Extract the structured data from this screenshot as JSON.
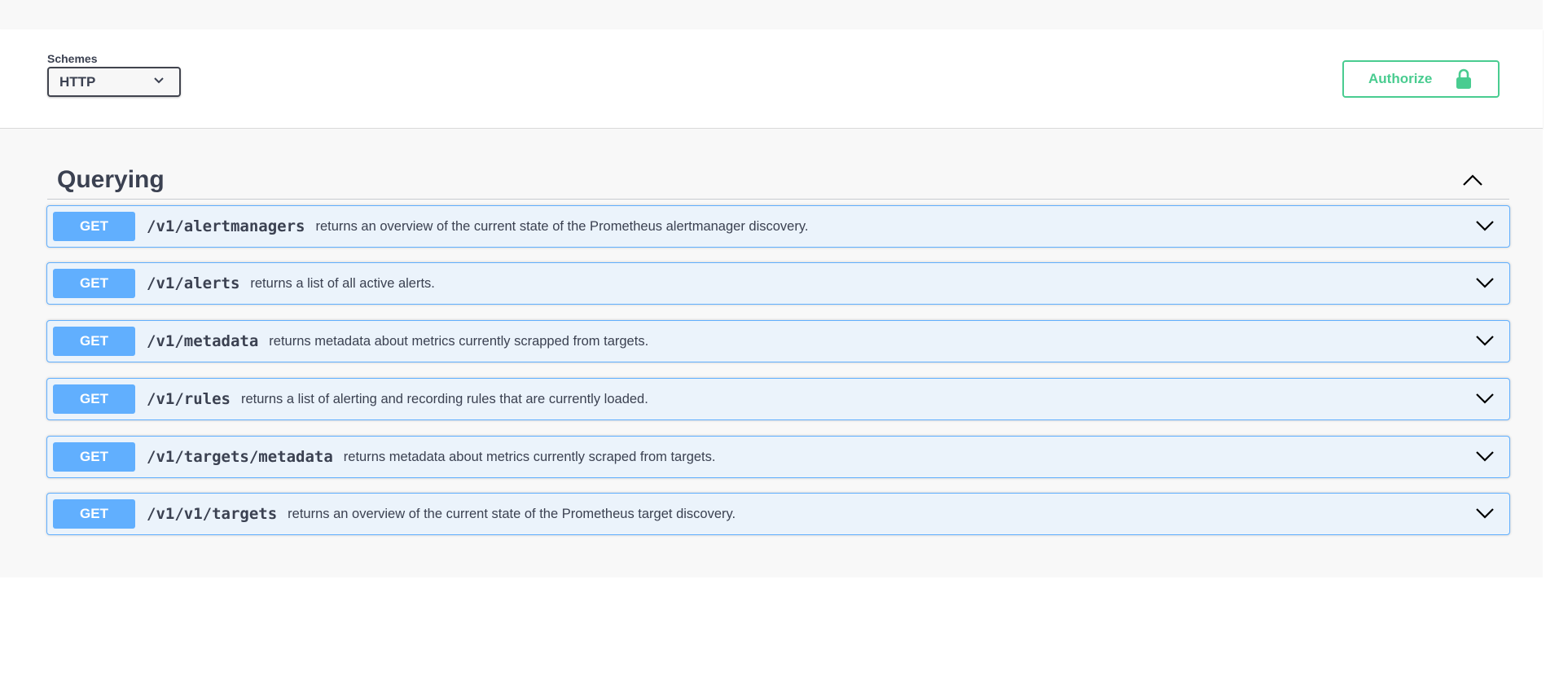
{
  "schemes": {
    "label": "Schemes",
    "selected": "HTTP"
  },
  "authorize": {
    "label": "Authorize",
    "icon": "lock-icon",
    "color": "#49cc90"
  },
  "tag": {
    "title": "Querying",
    "expanded": true
  },
  "operations": [
    {
      "method": "GET",
      "path": "/v1/alertmanagers",
      "summary": "returns an overview of the current state of the Prometheus alertmanager discovery."
    },
    {
      "method": "GET",
      "path": "/v1/alerts",
      "summary": "returns a list of all active alerts."
    },
    {
      "method": "GET",
      "path": "/v1/metadata",
      "summary": "returns metadata about metrics currently scrapped from targets."
    },
    {
      "method": "GET",
      "path": "/v1/rules",
      "summary": "returns a list of alerting and recording rules that are currently loaded."
    },
    {
      "method": "GET",
      "path": "/v1/targets/metadata",
      "summary": "returns metadata about metrics currently scraped from targets."
    },
    {
      "method": "GET",
      "path": "/v1/v1/targets",
      "summary": "returns an overview of the current state of the Prometheus target discovery."
    }
  ],
  "colors": {
    "get_method": "#61affe",
    "get_background": "#ebf3fb",
    "text": "#3b4151"
  }
}
